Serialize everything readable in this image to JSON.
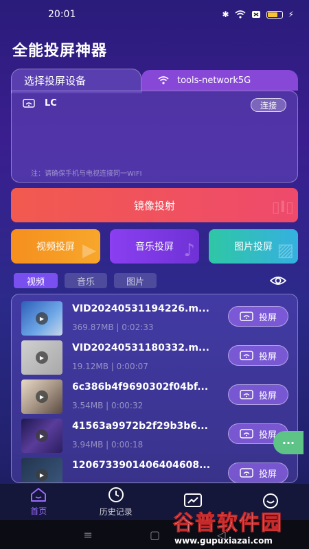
{
  "status_bar": {
    "time": "20:01"
  },
  "app": {
    "title": "全能投屏神器"
  },
  "device_panel": {
    "tab_label": "选择投屏设备",
    "network_name": "tools-network5G",
    "device_name": "LC",
    "connect_label": "连接",
    "note": "注：请确保手机与电视连接同一WIFI"
  },
  "mirror": {
    "label": "镜像投射"
  },
  "cast_cards": [
    {
      "label": "视频投屏"
    },
    {
      "label": "音乐投屏"
    },
    {
      "label": "图片投屏"
    }
  ],
  "filter_tabs": [
    {
      "label": "视频",
      "active": true
    },
    {
      "label": "音乐",
      "active": false
    },
    {
      "label": "图片",
      "active": false
    }
  ],
  "media_items": [
    {
      "name": "VID20240531194226.m...",
      "size": "369.87MB",
      "duration": "0:02:33",
      "cast_label": "投屏",
      "thumb_color": "#3b6fc2"
    },
    {
      "name": "VID20240531180332.m...",
      "size": "19.12MB",
      "duration": "0:00:07",
      "cast_label": "投屏",
      "thumb_color": "#b7b7b7"
    },
    {
      "name": "6c386b4f9690302f04bf...",
      "size": "3.54MB",
      "duration": "0:00:32",
      "cast_label": "投屏",
      "thumb_color": "#c9b8a8"
    },
    {
      "name": "41563a9972b2f29b3b6...",
      "size": "3.94MB",
      "duration": "0:00:18",
      "cast_label": "投屏",
      "thumb_color": "#3a2e6e"
    },
    {
      "name": "1206733901406404608...",
      "size": "",
      "duration": "",
      "cast_label": "投屏",
      "thumb_color": "#2a3d5c"
    }
  ],
  "bottom_nav": [
    {
      "label": "首页",
      "icon": "home-icon",
      "active": true
    },
    {
      "label": "历史记录",
      "icon": "clock-icon",
      "active": false
    },
    {
      "label": "",
      "icon": "chart-icon",
      "active": false
    },
    {
      "label": "",
      "icon": "smile-icon",
      "active": false
    }
  ],
  "watermark": {
    "main": "谷普软件园",
    "sub": "www.gupuxiazai.com"
  },
  "colors": {
    "accent": "#7a4ff0",
    "mirror": "#f25a4f",
    "video": "#f68f1e",
    "music": "#8a3ff0",
    "photo": "#2fc7a5",
    "fab": "#5dc387"
  }
}
